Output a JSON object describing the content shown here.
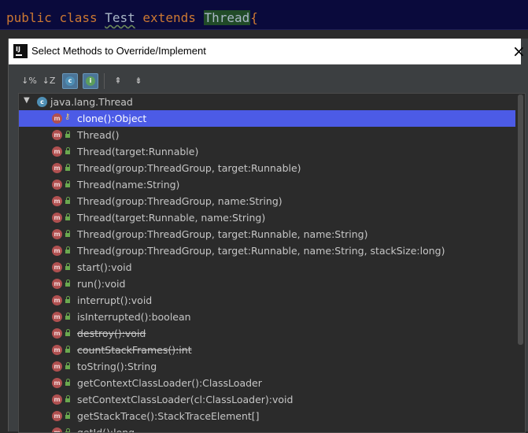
{
  "editor": {
    "tokens": [
      "public",
      "class",
      "Test",
      "extends",
      "Thread",
      "{"
    ]
  },
  "dialog": {
    "title": "Select Methods to Override/Implement",
    "toolbar": {
      "sort_alpha": "↓%",
      "sort_z": "↓Z",
      "c_badge": "c",
      "i_badge": "i",
      "expand_all": "⇞",
      "collapse_all": "⇟"
    },
    "tree": {
      "root": {
        "label": "java.lang.Thread",
        "badge": "c",
        "arrow": "▼"
      },
      "methods": [
        {
          "label": "clone():Object",
          "badge": "m",
          "access": "protected",
          "selected": true,
          "deprecated": false
        },
        {
          "label": "Thread()",
          "badge": "m",
          "access": "public",
          "selected": false,
          "deprecated": false
        },
        {
          "label": "Thread(target:Runnable)",
          "badge": "m",
          "access": "public",
          "selected": false,
          "deprecated": false
        },
        {
          "label": "Thread(group:ThreadGroup, target:Runnable)",
          "badge": "m",
          "access": "public",
          "selected": false,
          "deprecated": false
        },
        {
          "label": "Thread(name:String)",
          "badge": "m",
          "access": "public",
          "selected": false,
          "deprecated": false
        },
        {
          "label": "Thread(group:ThreadGroup, name:String)",
          "badge": "m",
          "access": "public",
          "selected": false,
          "deprecated": false
        },
        {
          "label": "Thread(target:Runnable, name:String)",
          "badge": "m",
          "access": "public",
          "selected": false,
          "deprecated": false
        },
        {
          "label": "Thread(group:ThreadGroup, target:Runnable, name:String)",
          "badge": "m",
          "access": "public",
          "selected": false,
          "deprecated": false
        },
        {
          "label": "Thread(group:ThreadGroup, target:Runnable, name:String, stackSize:long)",
          "badge": "m",
          "access": "public",
          "selected": false,
          "deprecated": false
        },
        {
          "label": "start():void",
          "badge": "m",
          "access": "public",
          "selected": false,
          "deprecated": false
        },
        {
          "label": "run():void",
          "badge": "m",
          "access": "public",
          "selected": false,
          "deprecated": false
        },
        {
          "label": "interrupt():void",
          "badge": "m",
          "access": "public",
          "selected": false,
          "deprecated": false
        },
        {
          "label": "isInterrupted():boolean",
          "badge": "m",
          "access": "public",
          "selected": false,
          "deprecated": false
        },
        {
          "label": "destroy():void",
          "badge": "m",
          "access": "public",
          "selected": false,
          "deprecated": true
        },
        {
          "label": "countStackFrames():int",
          "badge": "m",
          "access": "public",
          "selected": false,
          "deprecated": true
        },
        {
          "label": "toString():String",
          "badge": "m",
          "access": "public",
          "selected": false,
          "deprecated": false
        },
        {
          "label": "getContextClassLoader():ClassLoader",
          "badge": "m",
          "access": "public",
          "selected": false,
          "deprecated": false
        },
        {
          "label": "setContextClassLoader(cl:ClassLoader):void",
          "badge": "m",
          "access": "public",
          "selected": false,
          "deprecated": false
        },
        {
          "label": "getStackTrace():StackTraceElement[]",
          "badge": "m",
          "access": "public",
          "selected": false,
          "deprecated": false
        },
        {
          "label": "getId():long",
          "badge": "m",
          "access": "public",
          "selected": false,
          "deprecated": false
        }
      ]
    }
  },
  "colors": {
    "selection": "#4c5be6",
    "method_badge": "#b05050",
    "class_badge": "#4f8fb5",
    "public_lock": "#6aa84f",
    "protected_key": "#e8c96a"
  }
}
